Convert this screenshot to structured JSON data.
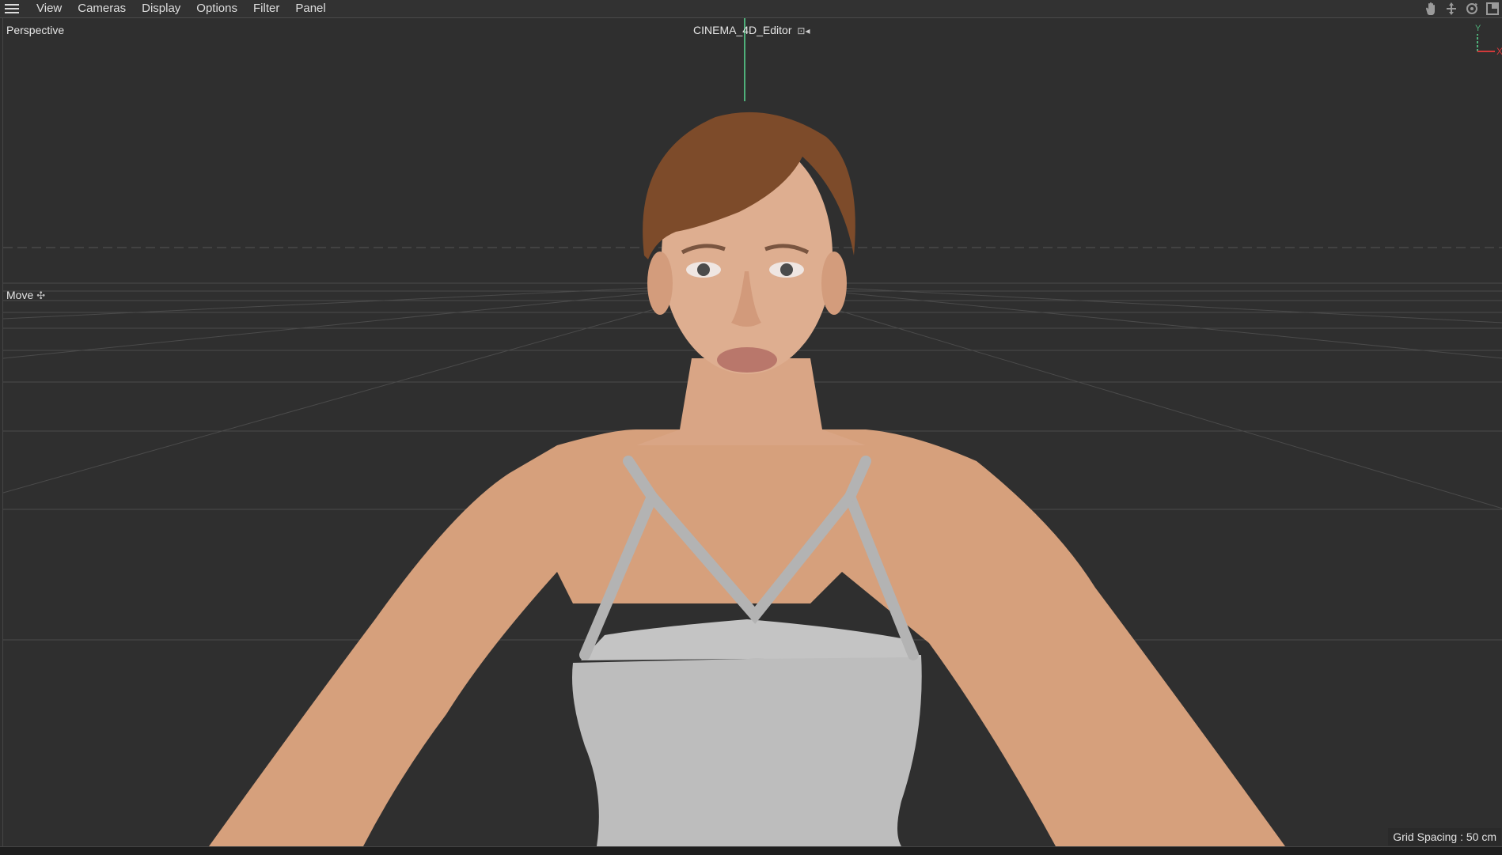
{
  "menubar": {
    "items": [
      {
        "label": "View"
      },
      {
        "label": "Cameras"
      },
      {
        "label": "Display"
      },
      {
        "label": "Options"
      },
      {
        "label": "Filter"
      },
      {
        "label": "Panel"
      }
    ],
    "nav_icons": [
      "hand-pan-icon",
      "move-arrows-icon",
      "rotate-orbit-icon",
      "maximize-view-icon"
    ]
  },
  "viewport": {
    "camera": "Perspective",
    "editor_camera": "CINEMA_4D_Editor",
    "active_tool": "Move",
    "grid_spacing": "Grid Spacing : 50 cm",
    "axis_labels": {
      "y": "Y",
      "x": "X"
    },
    "colors": {
      "background": "#2f2f2f",
      "grid_line": "#4b4b4b",
      "y_axis": "#4fb07a",
      "x_axis": "#d23a3a",
      "skin": "#d8a07c",
      "top": "#bdbdbd",
      "hair": "#7a4a2a"
    }
  }
}
